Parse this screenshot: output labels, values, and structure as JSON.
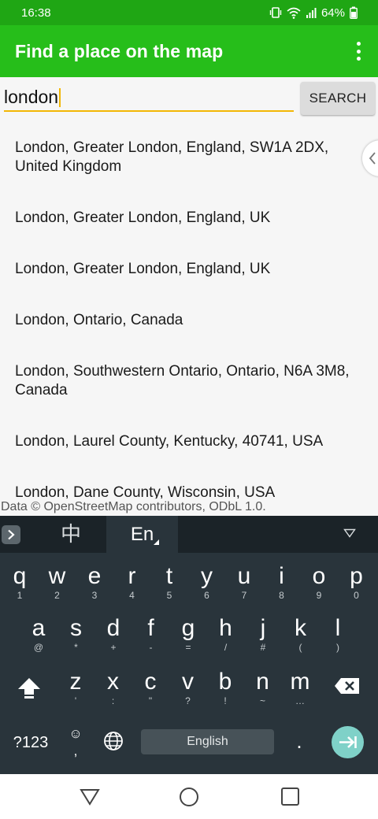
{
  "status_bar": {
    "time": "16:38",
    "battery_percent": "64%",
    "icons": [
      "vibrate-icon",
      "wifi-icon",
      "signal-icon",
      "battery-icon"
    ]
  },
  "app_bar": {
    "title": "Find a place on the map",
    "menu_icon": "overflow-menu-icon"
  },
  "search": {
    "query": "london",
    "button_label": "SEARCH",
    "accent_color": "#f2b705"
  },
  "results": [
    "London, Greater London, England, SW1A 2DX, United Kingdom",
    "London, Greater London, England, UK",
    "London, Greater London, England, UK",
    "London, Ontario, Canada",
    "London, Southwestern Ontario, Ontario, N6A 3M8, Canada",
    "London, Laurel County, Kentucky, 40741, USA",
    "London, Dane County, Wisconsin, USA"
  ],
  "attribution": "Data © OpenStreetMap contributors, ODbL 1.0.",
  "keyboard": {
    "lang_chinese": "中",
    "lang_english": "En",
    "row1": [
      {
        "key": "q",
        "sub": "1"
      },
      {
        "key": "w",
        "sub": "2"
      },
      {
        "key": "e",
        "sub": "3"
      },
      {
        "key": "r",
        "sub": "4"
      },
      {
        "key": "t",
        "sub": "5"
      },
      {
        "key": "y",
        "sub": "6"
      },
      {
        "key": "u",
        "sub": "7"
      },
      {
        "key": "i",
        "sub": "8"
      },
      {
        "key": "o",
        "sub": "9"
      },
      {
        "key": "p",
        "sub": "0"
      }
    ],
    "row2": [
      {
        "key": "a",
        "sub": "@"
      },
      {
        "key": "s",
        "sub": "*"
      },
      {
        "key": "d",
        "sub": "+"
      },
      {
        "key": "f",
        "sub": "-"
      },
      {
        "key": "g",
        "sub": "="
      },
      {
        "key": "h",
        "sub": "/"
      },
      {
        "key": "j",
        "sub": "#"
      },
      {
        "key": "k",
        "sub": "("
      },
      {
        "key": "l",
        "sub": ")"
      }
    ],
    "row3": [
      {
        "key": "z",
        "sub": "'"
      },
      {
        "key": "x",
        "sub": ":"
      },
      {
        "key": "c",
        "sub": "\""
      },
      {
        "key": "v",
        "sub": "?"
      },
      {
        "key": "b",
        "sub": "!"
      },
      {
        "key": "n",
        "sub": "~"
      },
      {
        "key": "m",
        "sub": "…"
      }
    ],
    "symbols_label": "?123",
    "emoji_label": "☺",
    "emoji_sub": ",",
    "space_label": "English",
    "period_label": ".",
    "enter_color": "#7fd1c8"
  },
  "colors": {
    "status_bar": "#1fa614",
    "app_bar": "#26be1a",
    "keyboard_bg": "#29343b"
  }
}
